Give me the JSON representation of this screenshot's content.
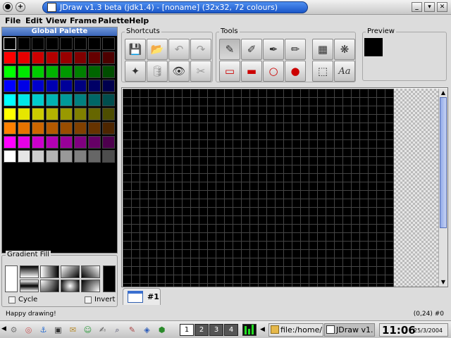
{
  "window": {
    "title": "JDraw v1.3 beta (jdk1.4)  -  [noname] (32x32, 72 colours)",
    "title_icon": "jdraw-pen-icon",
    "controls": [
      "minimize-icon",
      "maximize-icon",
      "close-icon"
    ]
  },
  "menubar": {
    "items": [
      "File",
      "Edit",
      "View",
      "Frame",
      "Palette",
      "Help"
    ]
  },
  "palette": {
    "title": "Global  Palette",
    "columns": 8,
    "colors": [
      "#000000",
      "#000000",
      "#000000",
      "#000000",
      "#000000",
      "#000000",
      "#000000",
      "#000000",
      "#ff0000",
      "#e60000",
      "#cc0000",
      "#b30000",
      "#990000",
      "#800000",
      "#660000",
      "#4d0000",
      "#00ff00",
      "#00e600",
      "#00cc00",
      "#00b300",
      "#009900",
      "#008000",
      "#006600",
      "#004d00",
      "#0000ff",
      "#0000e6",
      "#0000cc",
      "#0000b3",
      "#000099",
      "#000080",
      "#000066",
      "#00004d",
      "#00ffff",
      "#00e6e6",
      "#00cccc",
      "#00b3b3",
      "#009999",
      "#008080",
      "#006666",
      "#004d4d",
      "#ffff00",
      "#e6e600",
      "#cccc00",
      "#b3b300",
      "#999900",
      "#808000",
      "#666600",
      "#4d4d00",
      "#ff8000",
      "#e67300",
      "#cc6600",
      "#b35900",
      "#994d00",
      "#804000",
      "#663300",
      "#4d2600",
      "#ff00ff",
      "#e600e6",
      "#cc00cc",
      "#b300b3",
      "#990099",
      "#800080",
      "#660066",
      "#4d004d",
      "#ffffff",
      "#e6e6e6",
      "#cccccc",
      "#b3b3b3",
      "#999999",
      "#808080",
      "#666666",
      "#4d4d4d"
    ]
  },
  "gradient": {
    "label": "Gradient Fill",
    "cycle_label": "Cycle",
    "invert_label": "Invert",
    "start_color": "#ffffff",
    "end_color": "#000000"
  },
  "shortcuts": {
    "label": "Shortcuts",
    "buttons": [
      {
        "name": "save-icon",
        "glyph": "💾",
        "enabled": true
      },
      {
        "name": "open-folder-icon",
        "glyph": "📂",
        "enabled": true
      },
      {
        "name": "undo-icon",
        "glyph": "↶",
        "enabled": false
      },
      {
        "name": "redo-icon",
        "glyph": "↷",
        "enabled": false
      },
      {
        "name": "new-frame-icon",
        "glyph": "✦",
        "enabled": true
      },
      {
        "name": "database-icon",
        "glyph": "🛢",
        "enabled": false
      },
      {
        "name": "eye-icon",
        "glyph": "👁",
        "enabled": true
      },
      {
        "name": "scissors-icon",
        "glyph": "✂",
        "enabled": false
      }
    ]
  },
  "tools": {
    "label": "Tools",
    "buttons": [
      {
        "name": "pencil-icon",
        "glyph": "✎",
        "pressed": true
      },
      {
        "name": "brush-icon",
        "glyph": "✐",
        "pressed": false
      },
      {
        "name": "color-picker-icon",
        "glyph": "✒",
        "pressed": false
      },
      {
        "name": "airbrush-icon",
        "glyph": "✏",
        "pressed": false
      },
      {
        "name": "rectangle-outline-icon",
        "glyph": "▭",
        "pressed": false
      },
      {
        "name": "rectangle-filled-icon",
        "glyph": "▬",
        "pressed": false
      },
      {
        "name": "oval-outline-icon",
        "glyph": "○",
        "pressed": false
      },
      {
        "name": "oval-filled-icon",
        "glyph": "●",
        "pressed": false
      },
      {
        "name": "gradient-tool-icon",
        "glyph": "▦",
        "pressed": false
      },
      {
        "name": "fill-tool-icon",
        "glyph": "❋",
        "pressed": false
      },
      {
        "name": "selection-icon",
        "glyph": "⬚",
        "pressed": false
      },
      {
        "name": "text-tool-icon",
        "glyph": "Aa",
        "pressed": false
      }
    ]
  },
  "preview": {
    "label": "Preview"
  },
  "canvas": {
    "tab_label": "#1"
  },
  "status": {
    "message": "Happy drawing!",
    "coords": "(0,24) #0"
  },
  "taskbar": {
    "desktops": [
      "1",
      "2",
      "3",
      "4"
    ],
    "active_desktop": "1",
    "tasks": [
      {
        "label": "file:/home/",
        "active": false
      },
      {
        "label": "JDraw v1.",
        "active": true
      }
    ],
    "clock_time": "11:06",
    "clock_date": "25/3/2004",
    "launchers": [
      "gear-icon",
      "lifebuoy-icon",
      "konqueror-icon",
      "terminal-icon",
      "mail-icon",
      "chat-icon",
      "editor-icon",
      "search-icon",
      "paint-icon",
      "kde-icon",
      "network-icon"
    ]
  }
}
